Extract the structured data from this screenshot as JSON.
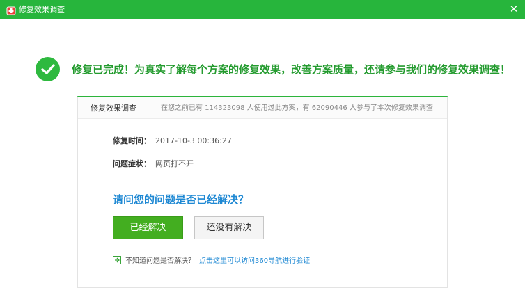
{
  "window": {
    "title": "修复效果调查",
    "close_symbol": "✕",
    "accent_color": "#27b53c"
  },
  "headline": "修复已完成！为真实了解每个方案的修复效果，改善方案质量，还请参与我们的修复效果调查！",
  "panel": {
    "tab_label": "修复效果调查",
    "stats": "在您之前已有 114323098 人使用过此方案，有 62090446 人参与了本次修复效果调查",
    "repair_time_label": "修复时间：",
    "repair_time_value": "2017-10-3 00:36:27",
    "symptom_label": "问题症状：",
    "symptom_value": "网页打不开",
    "question": "请问您的问题是否已经解决？",
    "solved_button": "已经解决",
    "unsolved_button": "还没有解决",
    "unsure_text": "不知道问题是否解决？",
    "verify_link": "点击这里可以访问360导航进行验证"
  },
  "icons": {
    "title": "first-aid-kit-icon",
    "success": "check-circle-icon",
    "verify": "arrow-right-box-icon",
    "close": "close-icon"
  }
}
